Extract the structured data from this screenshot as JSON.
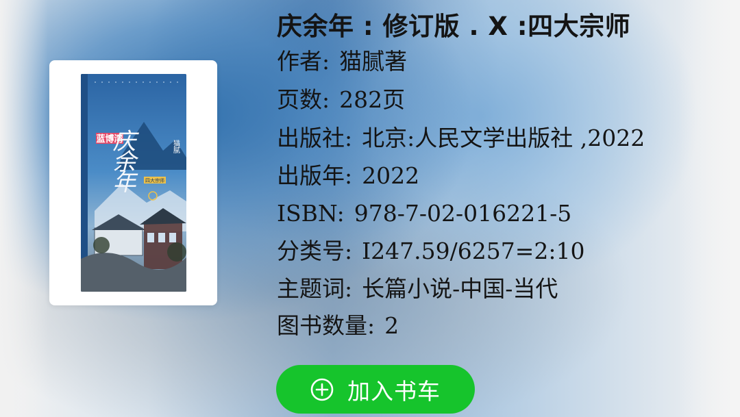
{
  "book": {
    "title": "庆余年 : 修订版 . X :四大宗师",
    "cover": {
      "series_text": "庆余年",
      "author_text": "猫腻",
      "sticker_text": "蓝博湾",
      "subtitle_text": "四大宗师"
    },
    "fields": [
      {
        "label": "作者:",
        "value": "猫腻著"
      },
      {
        "label": "页数:",
        "value": "282页"
      },
      {
        "label": "出版社:",
        "value": "北京:人民文学出版社 ,2022"
      },
      {
        "label": "出版年:",
        "value": "2022"
      },
      {
        "label": "ISBN:",
        "value": "978-7-02-016221-5"
      },
      {
        "label": "分类号:",
        "value": "I247.59/6257=2:10"
      },
      {
        "label": "主题词:",
        "value": "长篇小说-中国-当代"
      },
      {
        "label": "图书数量:",
        "value": "2"
      }
    ]
  },
  "actions": {
    "add_to_cart_label": "加入书车",
    "add_icon": "plus-circle-icon"
  },
  "colors": {
    "button_green": "#16c42c",
    "text": "#141414",
    "cover_blue": "#2f69a6"
  }
}
